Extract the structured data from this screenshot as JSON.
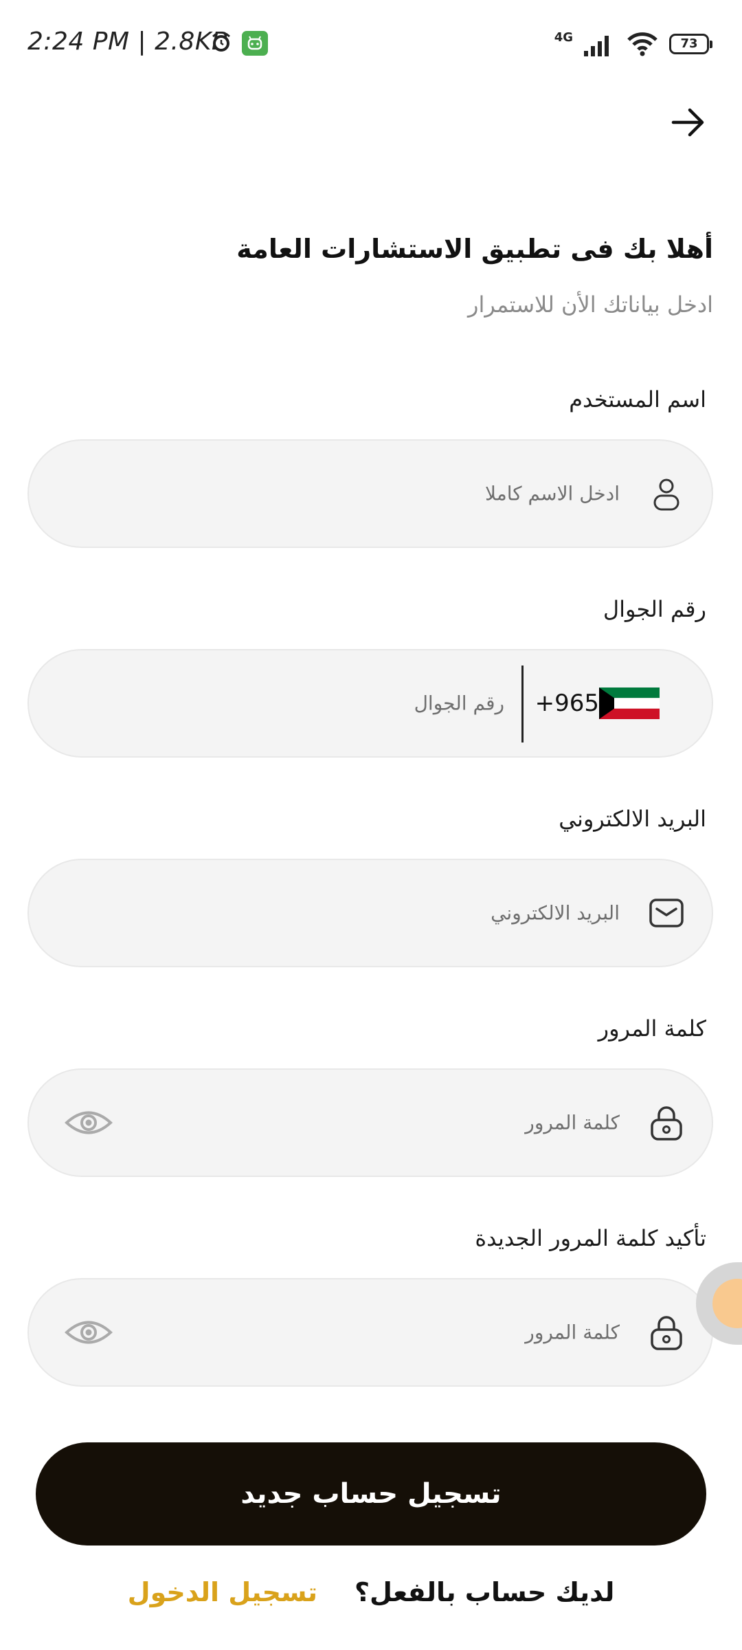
{
  "status_bar": {
    "time": "2:24 PM | 2.8KB",
    "network": "4G",
    "battery": "73"
  },
  "header": {
    "title": "أهلا بك فى تطبيق الاستشارات العامة",
    "subtitle": "ادخل بياناتك الأن للاستمرار"
  },
  "form": {
    "username": {
      "label": "اسم المستخدم",
      "placeholder": "ادخل الاسم كاملا",
      "icon": "user-icon"
    },
    "phone": {
      "label": "رقم الجوال",
      "country_code": "+965",
      "placeholder": "رقم الجوال",
      "flag": "kuwait-flag-icon"
    },
    "email": {
      "label": "البريد الالكتروني",
      "placeholder": "البريد الالكتروني",
      "icon": "mail-icon"
    },
    "password": {
      "label": "كلمة المرور",
      "placeholder": "كلمة المرور",
      "icon": "lock-icon"
    },
    "confirm_password": {
      "label": "تأكيد كلمة المرور الجديدة",
      "placeholder": "كلمة المرور",
      "icon": "lock-icon"
    }
  },
  "actions": {
    "register_label": "تسجيل حساب جديد",
    "have_account_text": "لديك حساب بالفعل؟",
    "login_label": "تسجيل الدخول"
  },
  "colors": {
    "primary_button": "#150f07",
    "link": "#d9a21b",
    "field_bg": "#f4f4f4",
    "placeholder": "#6e6e6e"
  }
}
